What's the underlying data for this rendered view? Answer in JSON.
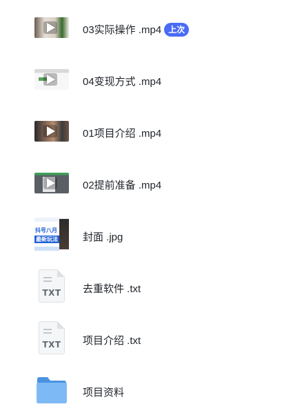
{
  "files": [
    {
      "name": "03实际操作 .mp4",
      "type": "video",
      "badge": "上次",
      "thumb_colors": [
        "#5b4f45",
        "#e9e3dc",
        "#3a6b2e"
      ]
    },
    {
      "name": "04变现方式 .mp4",
      "type": "video",
      "thumb_colors": [
        "#dcdcdc",
        "#f4f4f4",
        "#5aa35a"
      ]
    },
    {
      "name": "01项目介绍 .mp4",
      "type": "video",
      "thumb_colors": [
        "#2a2a2a",
        "#7a5a4a",
        "#a07b62"
      ]
    },
    {
      "name": "02提前准备 .mp4",
      "type": "video",
      "thumb_colors": [
        "#555a60",
        "#dfe3e6",
        "#3f9f5a"
      ]
    },
    {
      "name": "封面 .jpg",
      "type": "image",
      "thumb_text": [
        "抖号八月",
        "最新玩法"
      ]
    },
    {
      "name": "去重软件 .txt",
      "type": "txt",
      "icon_label": "TXT"
    },
    {
      "name": "项目介绍 .txt",
      "type": "txt",
      "icon_label": "TXT"
    },
    {
      "name": "项目资料",
      "type": "folder"
    }
  ],
  "colors": {
    "badge_bg": "#4a6cf7",
    "text": "#1f2329",
    "folder": "#5ea8f0"
  }
}
